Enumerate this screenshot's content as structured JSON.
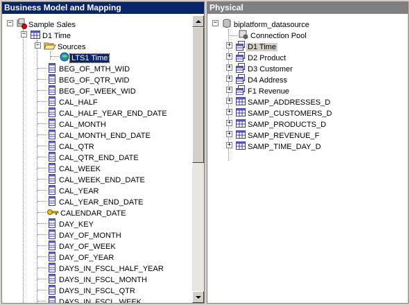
{
  "left_pane": {
    "title": "Business Model and Mapping",
    "business_model": "Sample Sales",
    "table": "D1 Time",
    "sources_folder": "Sources",
    "source": "LTS1 Time",
    "columns": [
      "BEG_OF_MTH_WID",
      "BEG_OF_QTR_WID",
      "BEG_OF_WEEK_WID",
      "CAL_HALF",
      "CAL_HALF_YEAR_END_DATE",
      "CAL_MONTH",
      "CAL_MONTH_END_DATE",
      "CAL_QTR",
      "CAL_QTR_END_DATE",
      "CAL_WEEK",
      "CAL_WEEK_END_DATE",
      "CAL_YEAR",
      "CAL_YEAR_END_DATE",
      "CALENDAR_DATE",
      "DAY_KEY",
      "DAY_OF_MONTH",
      "DAY_OF_WEEK",
      "DAY_OF_YEAR",
      "DAYS_IN_FSCL_HALF_YEAR",
      "DAYS_IN_FSCL_MONTH",
      "DAYS_IN_FSCL_QTR",
      "DAYS_IN_FSCL_WEEK"
    ],
    "key_column": "CALENDAR_DATE"
  },
  "right_pane": {
    "title": "Physical",
    "datasource": "biplatform_datasource",
    "connection_pool": "Connection Pool",
    "aliases": [
      "D1 Time",
      "D2 Product",
      "D3 Customer",
      "D4 Address",
      "F1 Revenue"
    ],
    "tables": [
      "SAMP_ADDRESSES_D",
      "SAMP_CUSTOMERS_D",
      "SAMP_PRODUCTS_D",
      "SAMP_REVENUE_F",
      "SAMP_TIME_DAY_D"
    ]
  },
  "colors": {
    "active_title": "#0a246a",
    "inactive_title": "#808080",
    "selection": "#0a246a"
  }
}
